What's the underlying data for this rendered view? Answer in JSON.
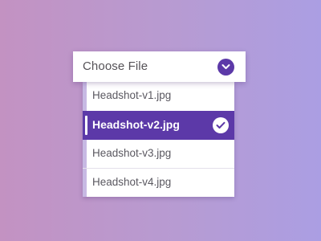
{
  "colors": {
    "accent": "#5c39a8",
    "background_left": "#c392c2",
    "background_right": "#ab9ee3",
    "rail": "#c7b9e3",
    "text": "#5a5860"
  },
  "file_select": {
    "label": "Choose File",
    "toggle_icon": "chevron-down-icon"
  },
  "menu": {
    "items": [
      {
        "label": "Headshot-v1.jpg"
      },
      {
        "label": "Headshot-v2.jpg",
        "selected": true,
        "icon": "check-icon"
      },
      {
        "label": "Headshot-v3.jpg"
      },
      {
        "label": "Headshot-v4.jpg"
      }
    ]
  }
}
